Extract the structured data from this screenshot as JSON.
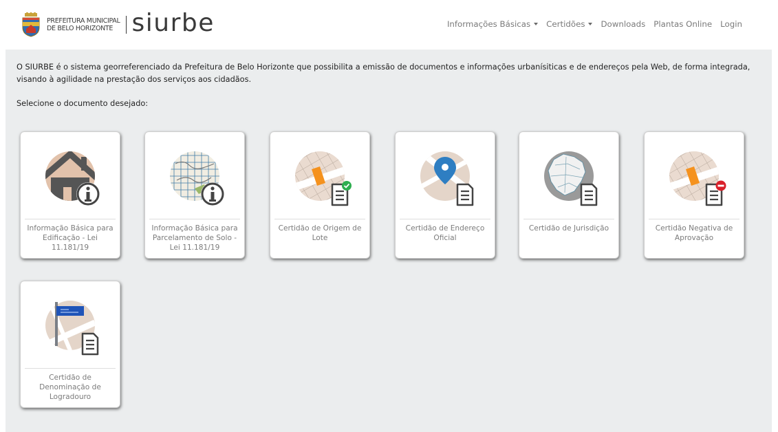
{
  "header": {
    "brand_line1": "PREFEITURA MUNICIPAL",
    "brand_line2": "DE BELO HORIZONTE",
    "app_name": "siurbe",
    "nav": [
      {
        "label": "Informações Básicas",
        "dropdown": true
      },
      {
        "label": "Certidões",
        "dropdown": true
      },
      {
        "label": "Downloads",
        "dropdown": false
      },
      {
        "label": "Plantas Online",
        "dropdown": false
      },
      {
        "label": "Login",
        "dropdown": false
      }
    ]
  },
  "intro": {
    "text": "O SIURBE é o sistema georreferenciado da Prefeitura de Belo Horizonte que possibilita a emissão de documentos e informações urbanísiticas e de endereços pela Web, de forma integrada, visando à agilidade na prestação dos serviços aos cidadãos.",
    "prompt": "Selecione o documento desejado:"
  },
  "cards": [
    {
      "label": "Informação Básica para Edificação - Lei 11.181/19",
      "icon": "house-info-icon"
    },
    {
      "label": "Informação Básica para Parcelamento de Solo - Lei 11.181/19",
      "icon": "map-info-icon"
    },
    {
      "label": "Certidão de Origem de Lote",
      "icon": "lot-certificate-check-icon"
    },
    {
      "label": "Certidão de Endereço Oficial",
      "icon": "address-pin-document-icon"
    },
    {
      "label": "Certidão de Jurisdição",
      "icon": "jurisdiction-map-document-icon"
    },
    {
      "label": "Certidão Negativa de Aprovação",
      "icon": "lot-certificate-denied-icon"
    },
    {
      "label": "Certidão de Denominação de Logradouro",
      "icon": "street-sign-document-icon"
    }
  ],
  "colors": {
    "content_bg": "#ebedee",
    "lot_orange": "#f5921e",
    "pin_blue": "#2e7ec2",
    "check_green": "#2eae4f",
    "deny_red": "#d9202a",
    "street_sign_blue": "#1f54b8"
  }
}
